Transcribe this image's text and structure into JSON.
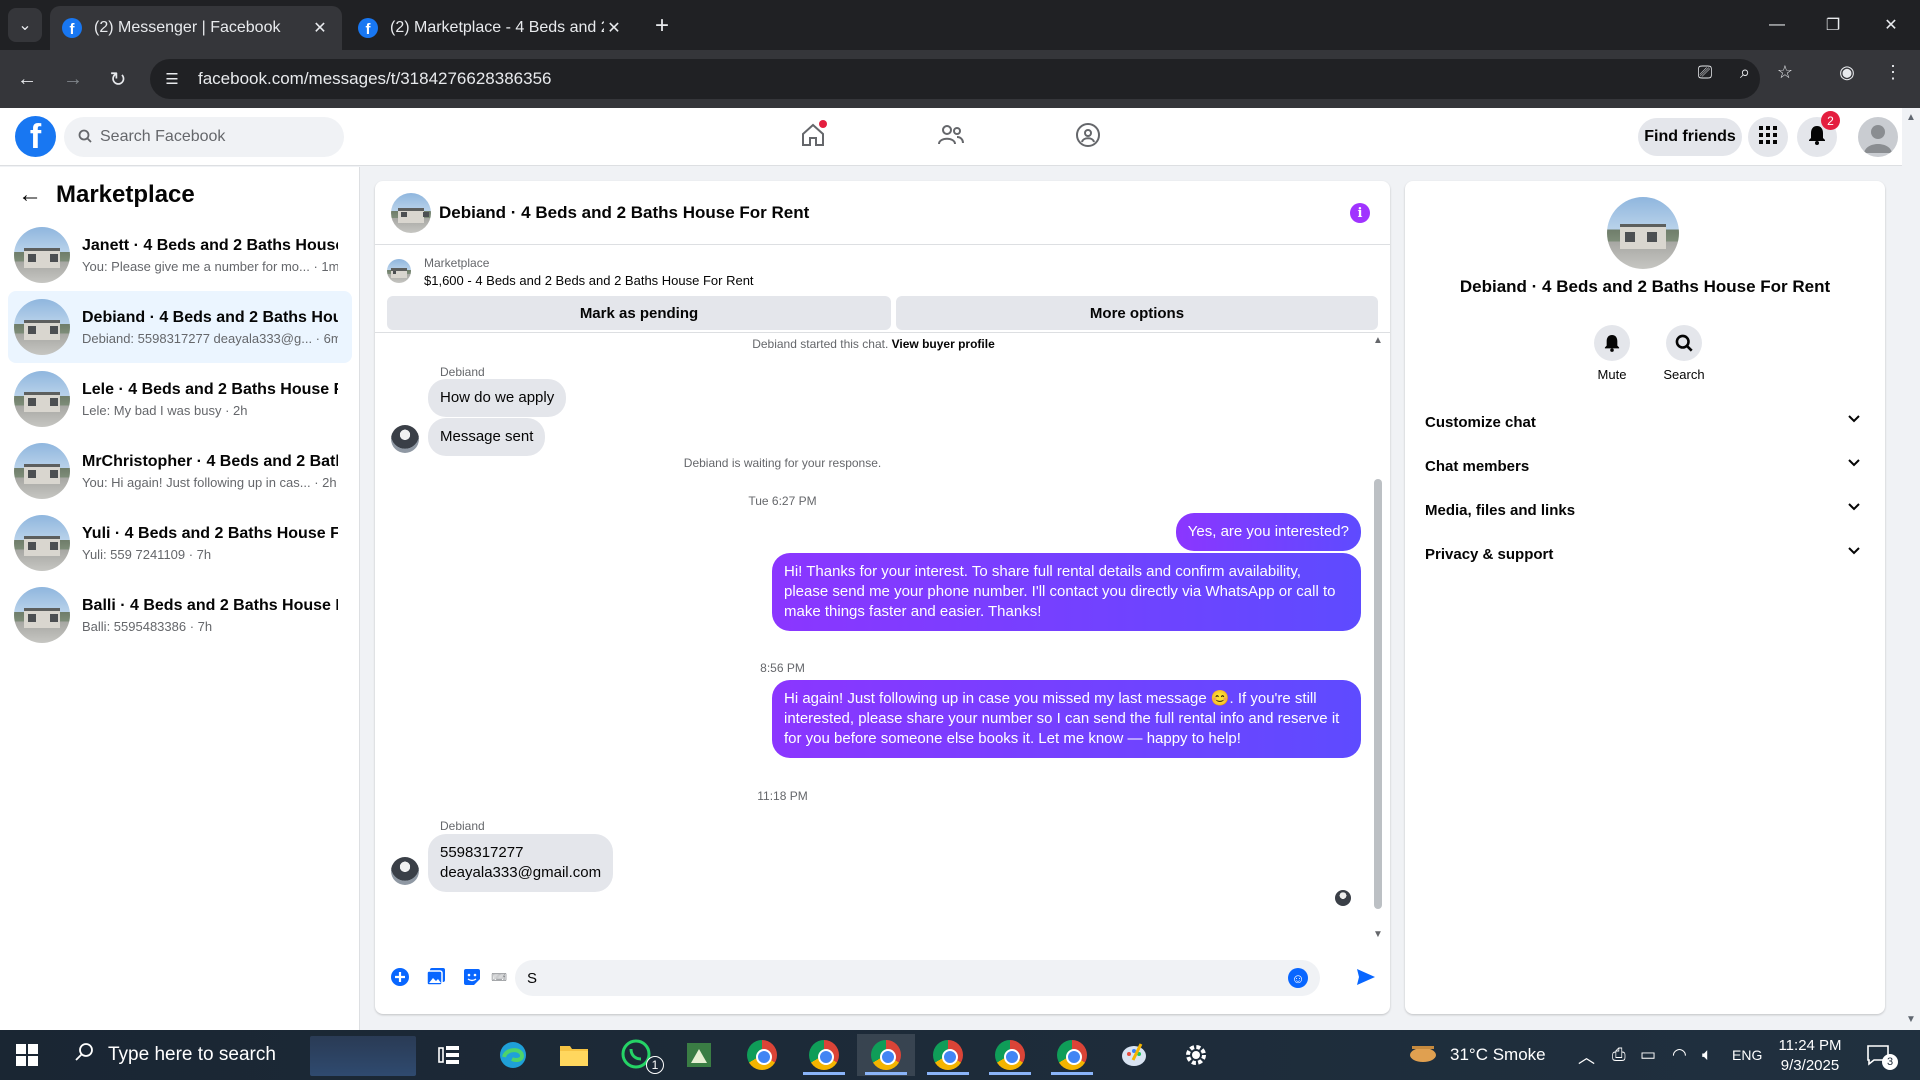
{
  "browser": {
    "tabs": [
      {
        "title": "(2) Messenger | Facebook",
        "active": true
      },
      {
        "title": "(2) Marketplace - 4 Beds and 2",
        "active": false
      }
    ],
    "url": "facebook.com/messages/t/3184276628386356"
  },
  "fb_header": {
    "search_placeholder": "Search Facebook",
    "find_friends": "Find friends",
    "notification_count": "2"
  },
  "left_panel": {
    "title": "Marketplace",
    "conversations": [
      {
        "name": "Janett · 4 Beds and 2 Baths House ...",
        "preview": "You: Please give me a number for mo... · 1m"
      },
      {
        "name": "Debiand · 4 Beds and 2 Baths Hou...",
        "preview": "Debiand: 5598317277 deayala333@g... · 6m"
      },
      {
        "name": "Lele · 4 Beds and 2 Baths House F...",
        "preview": "Lele: My bad I was busy · 2h"
      },
      {
        "name": "MrChristopher · 4 Beds and 2 Bath...",
        "preview": "You: Hi again! Just following up in cas... · 2h"
      },
      {
        "name": "Yuli · 4 Beds and 2 Baths House Fo...",
        "preview": "Yuli: 559 7241109 · 7h"
      },
      {
        "name": "Balli · 4 Beds and 2 Baths House F...",
        "preview": "Balli: 5595483386 · 7h"
      }
    ]
  },
  "chat": {
    "title": "Debiand · 4 Beds and 2 Baths House For Rent",
    "marketplace_label": "Marketplace",
    "listing": "$1,600 - 4 Beds and 2 Beds and 2 Baths House For Rent",
    "mark_pending": "Mark as pending",
    "more_options": "More options",
    "started_text": "Debiand started this chat.",
    "view_buyer_profile": "View buyer profile",
    "sender_name": "Debiand",
    "msg_how_apply": "How do we apply",
    "msg_sent": "Message sent",
    "waiting_text": "Debiand is waiting for your response.",
    "time_1": "Tue 6:27 PM",
    "out_1": "Yes, are you interested?",
    "out_2": "Hi! Thanks for your interest. To share full rental details and confirm availability, please send me your phone number. I'll contact you directly via WhatsApp or call to make things faster and easier. Thanks!",
    "time_2": "8:56 PM",
    "out_3": "Hi again! Just following up in case you missed my last message 😊. If you're still interested, please share your number so I can send the full rental info and reserve it for you before someone else books it. Let me know — happy to help!",
    "time_3": "11:18 PM",
    "in_phone": "5598317277",
    "in_email": "deayala333@gmail.com",
    "composer_value": "S"
  },
  "info_panel": {
    "name": "Debiand · 4 Beds and 2 Baths House For Rent",
    "mute": "Mute",
    "search": "Search",
    "sections": [
      "Customize chat",
      "Chat members",
      "Media, files and links",
      "Privacy & support"
    ]
  },
  "taskbar": {
    "search_placeholder": "Type here to search",
    "whatsapp_badge": "1",
    "weather": "31°C  Smoke",
    "language": "ENG",
    "time": "11:24 PM",
    "date": "9/3/2025",
    "notif_count": "3"
  }
}
